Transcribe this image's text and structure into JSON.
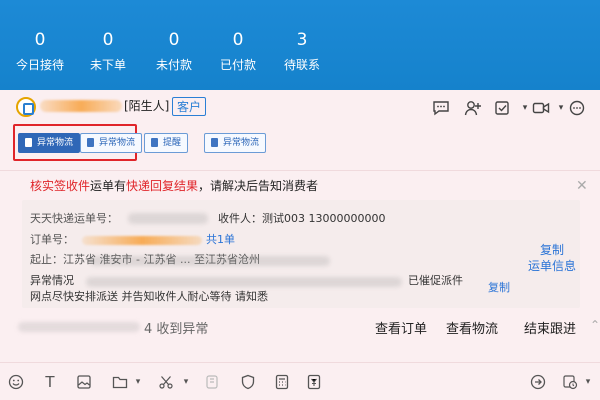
{
  "stats": [
    {
      "value": "0",
      "label": "今日接待"
    },
    {
      "value": "0",
      "label": "未下单"
    },
    {
      "value": "0",
      "label": "未付款"
    },
    {
      "value": "0",
      "label": "已付款"
    },
    {
      "value": "3",
      "label": "待联系"
    }
  ],
  "header": {
    "stranger_tag": "[陌生人]",
    "customer_tag": "客户"
  },
  "actions": {
    "btn1": "异常物流",
    "btn2": "异常物流",
    "btn3": "提醒",
    "btn4": "异常物流"
  },
  "message": {
    "warn_prefix": "核实签收件",
    "warn_mid1": "运单有",
    "warn_red2": "快递回复结果",
    "warn_suffix": "，请解决后告知消费者",
    "tracking_label": "天天快递运单号：",
    "tracking_num": "0003",
    "receiver": "收件人：测试003   13000000000",
    "order_label": "订单号：",
    "order_count": "共1单",
    "route": "起止：江苏省 淮安市 - 江苏省 ... 至江苏省沧州",
    "exception_label": "异常情况",
    "exception_text": "网点尽快安排派送 并告知收件人耐心等待 请知悉",
    "urged": "已催促派件",
    "copy": "复制",
    "copy_waybill": "复制\n运单信息"
  },
  "bottom": {
    "received": "4 收到异常",
    "view_order": "查看订单",
    "view_logistics": "查看物流",
    "end_follow": "结束跟进"
  }
}
